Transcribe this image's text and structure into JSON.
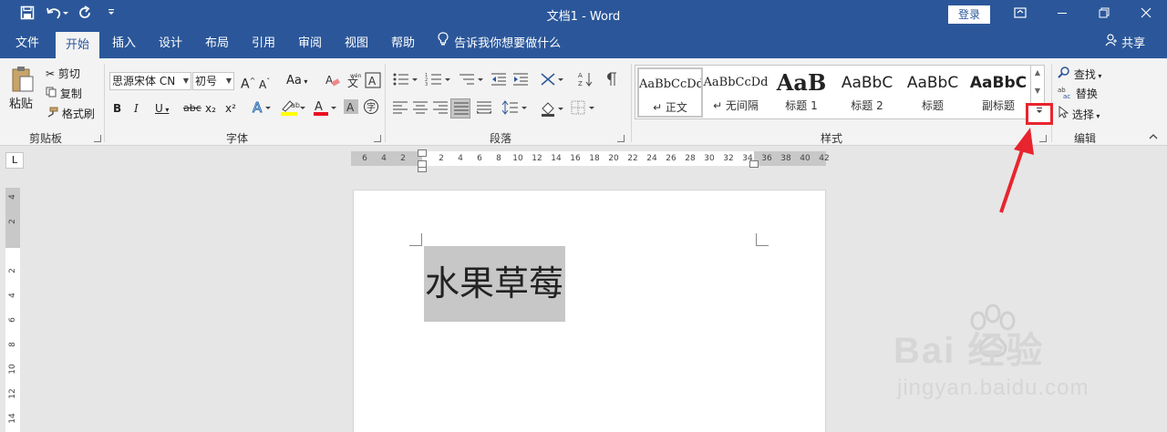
{
  "window": {
    "title": "文档1  -  Word",
    "login_label": "登录",
    "icons": {
      "save": "save-icon",
      "undo": "undo-icon",
      "redo": "redo-icon",
      "customize": "customize-quick-access-icon"
    }
  },
  "tabs": [
    "文件",
    "开始",
    "插入",
    "设计",
    "布局",
    "引用",
    "审阅",
    "视图",
    "帮助"
  ],
  "active_tab": "开始",
  "tell_me": "告诉我你想要做什么",
  "share_label": "共享",
  "clipboard": {
    "paste": "粘贴",
    "cut": "剪切",
    "copy": "复制",
    "format_painter": "格式刷",
    "group_label": "剪贴板"
  },
  "font": {
    "font_name": "思源宋体 CN",
    "font_size": "初号",
    "grow": "A",
    "shrink": "A",
    "change_case": "Aa",
    "bold": "B",
    "italic": "I",
    "underline": "U",
    "strikethrough": "abc",
    "subscript": "x₂",
    "superscript": "x²",
    "group_label": "字体"
  },
  "paragraph": {
    "group_label": "段落"
  },
  "styles": {
    "items": [
      {
        "sample": "AaBbCcDd",
        "name": "↵ 正文"
      },
      {
        "sample": "AaBbCcDd",
        "name": "↵ 无间隔"
      },
      {
        "sample": "AaB",
        "name": "标题 1"
      },
      {
        "sample": "AaBbC",
        "name": "标题 2"
      },
      {
        "sample": "AaBbC",
        "name": "标题"
      },
      {
        "sample": "AaBbC",
        "name": "副标题"
      }
    ],
    "group_label": "样式"
  },
  "editing": {
    "find": "查找",
    "replace": "替换",
    "select": "选择",
    "group_label": "编辑"
  },
  "ruler": {
    "corner": "L",
    "horizontal_ticks": [
      "6",
      "4",
      "2",
      "",
      "2",
      "4",
      "6",
      "8",
      "10",
      "12",
      "14",
      "16",
      "18",
      "20",
      "22",
      "24",
      "26",
      "28",
      "30",
      "32",
      "34",
      "36",
      "38",
      "40",
      "42"
    ],
    "vertical_ticks": [
      "4",
      "2",
      "",
      "2",
      "4",
      "6",
      "8",
      "10",
      "12",
      "14"
    ]
  },
  "document": {
    "text": "水果草莓"
  },
  "watermark": {
    "brand": "Bai  经验",
    "url": "jingyan.baidu.com"
  },
  "colors": {
    "accent": "#2b579a",
    "highlight_box": "#e8252e",
    "selection": "#c7c7c7"
  }
}
